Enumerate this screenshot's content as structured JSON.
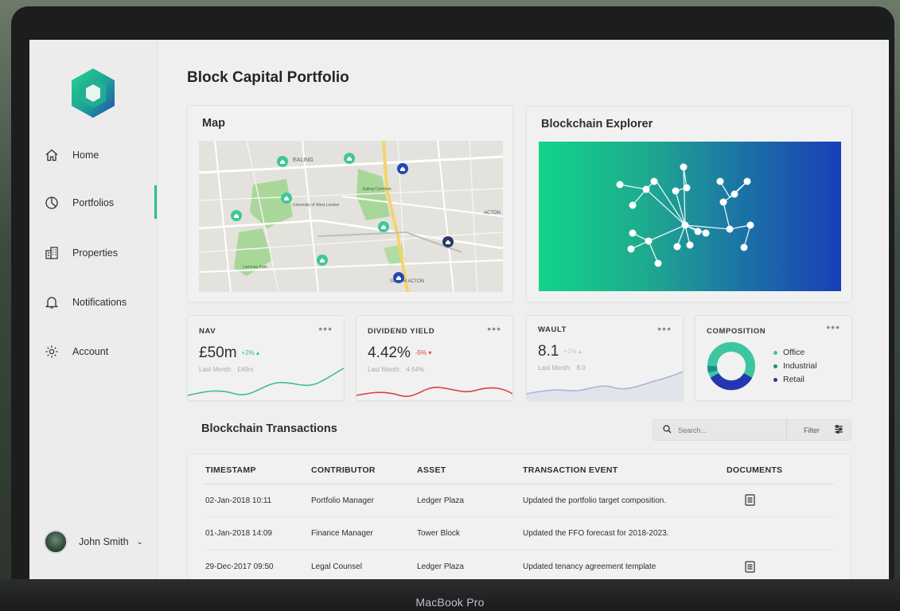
{
  "app": {
    "title": "Block Capital Portfolio",
    "device_label": "MacBook Pro"
  },
  "sidebar": {
    "items": [
      {
        "label": "Home",
        "icon": "home-icon"
      },
      {
        "label": "Portfolios",
        "icon": "pie-chart-icon",
        "active": true
      },
      {
        "label": "Properties",
        "icon": "building-icon"
      },
      {
        "label": "Notifications",
        "icon": "bell-icon"
      },
      {
        "label": "Account",
        "icon": "gear-icon"
      }
    ],
    "user": {
      "name": "John Smith"
    }
  },
  "map_card": {
    "title": "Map",
    "labels": [
      "EALING",
      "Ealing Common",
      "University of West London",
      "Lammas Park",
      "SOUTH ACTON",
      "ACTON"
    ]
  },
  "explorer_card": {
    "title": "Blockchain Explorer"
  },
  "metrics": [
    {
      "title": "NAV",
      "value": "£50m",
      "delta": "+2%",
      "delta_dir": "up",
      "sub_label": "Last Month:",
      "sub_value": "£49m",
      "color": "#3cc084"
    },
    {
      "title": "DIVIDEND YIELD",
      "value": "4.42%",
      "delta": "-5%",
      "delta_dir": "down",
      "sub_label": "Last Month:",
      "sub_value": "4.64%",
      "color": "#d9403a"
    },
    {
      "title": "WAULT",
      "value": "8.1",
      "delta": "+1%",
      "delta_dir": "up",
      "sub_label": "Last Month:",
      "sub_value": "8.0",
      "color": "#a9b4d6"
    }
  ],
  "composition": {
    "title": "COMPOSITION",
    "legend": [
      {
        "label": "Office",
        "color": "#3cc6a0"
      },
      {
        "label": "Industrial",
        "color": "#1c8f8a"
      },
      {
        "label": "Retail",
        "color": "#2437b0"
      }
    ]
  },
  "transactions": {
    "title": "Blockchain Transactions",
    "search_placeholder": "Search...",
    "filter_label": "Filter",
    "columns": [
      "TIMESTAMP",
      "CONTRIBUTOR",
      "ASSET",
      "TRANSACTION EVENT",
      "DOCUMENTS"
    ],
    "rows": [
      {
        "timestamp": "02-Jan-2018 10:11",
        "contributor": "Portfolio Manager",
        "asset": "Ledger Plaza",
        "event": "Updated the portfolio target composition.",
        "has_doc": true
      },
      {
        "timestamp": "01-Jan-2018 14:09",
        "contributor": "Finance Manager",
        "asset": "Tower Block",
        "event": "Updated the FFO forecast for 2018-2023.",
        "has_doc": false
      },
      {
        "timestamp": "29-Dec-2017 09:50",
        "contributor": "Legal Counsel",
        "asset": "Ledger Plaza",
        "event": "Updated tenancy agreement template",
        "has_doc": true
      }
    ]
  }
}
